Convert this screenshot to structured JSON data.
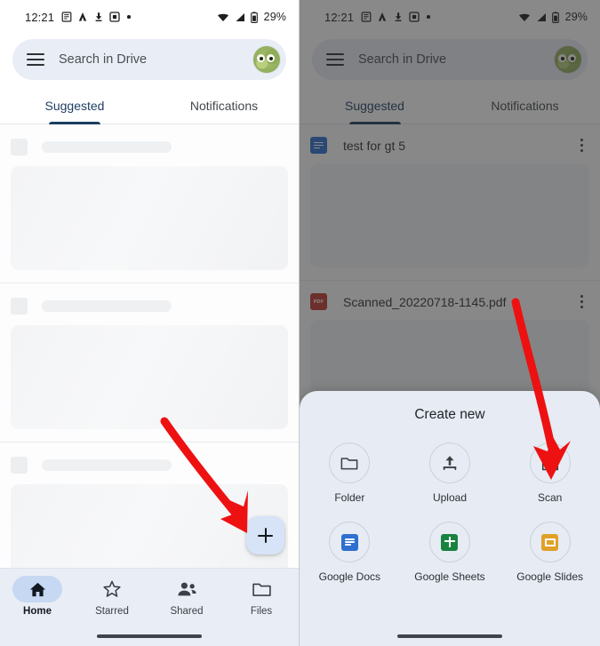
{
  "screenshot": {
    "kind": "android-google-drive-tutorial",
    "panels": 2
  },
  "status_bar": {
    "clock": "12:21",
    "left_icons": [
      "notes-notification-icon",
      "app-notification-icon",
      "download-notification-icon",
      "screenshot-notification-icon",
      "overflow-dot-icon"
    ],
    "right_icons": [
      "wifi-icon",
      "cellular-signal-icon",
      "battery-icon"
    ],
    "battery_percent": "29%"
  },
  "search": {
    "placeholder": "Search in Drive",
    "menu_icon": "hamburger-menu-icon",
    "avatar_icon": "account-avatar"
  },
  "tabs": [
    {
      "label": "Suggested",
      "active": true
    },
    {
      "label": "Notifications",
      "active": false
    }
  ],
  "bottom_nav": [
    {
      "label": "Home",
      "icon": "home-icon",
      "active": true
    },
    {
      "label": "Starred",
      "icon": "star-icon",
      "active": false
    },
    {
      "label": "Shared",
      "icon": "people-icon",
      "active": false
    },
    {
      "label": "Files",
      "icon": "folder-icon",
      "active": false
    }
  ],
  "fab": {
    "icon": "plus-icon",
    "label": "Create new",
    "color": "#d7e3f7"
  },
  "left_panel": {
    "skeleton_cards": [
      {
        "state": "loading-placeholder"
      },
      {
        "state": "loading-placeholder"
      },
      {
        "state": "loading-placeholder"
      }
    ]
  },
  "right_panel": {
    "files": [
      {
        "name": "test for gt 5",
        "icon": "google-docs-file-icon",
        "icon_color": "#2f6fd0",
        "menu": "overflow-menu-icon"
      },
      {
        "name": "Scanned_20220718-1145.pdf",
        "icon": "pdf-file-icon",
        "icon_color": "#c0392f",
        "menu": "overflow-menu-icon"
      }
    ],
    "scrim": true
  },
  "create_sheet": {
    "title": "Create new",
    "options": [
      {
        "label": "Folder",
        "icon": "folder-outline-icon",
        "color": "#3c4043"
      },
      {
        "label": "Upload",
        "icon": "upload-icon",
        "color": "#3c4043"
      },
      {
        "label": "Scan",
        "icon": "camera-scan-icon",
        "color": "#3c4043"
      },
      {
        "label": "Google Docs",
        "icon": "google-docs-icon",
        "color": "#2f6fd0"
      },
      {
        "label": "Google Sheets",
        "icon": "google-sheets-icon",
        "color": "#18833f"
      },
      {
        "label": "Google Slides",
        "icon": "google-slides-icon",
        "color": "#e0a128"
      }
    ]
  },
  "annotations": [
    {
      "type": "arrow",
      "color": "#ee1111",
      "points_to": "create-fab"
    },
    {
      "type": "arrow",
      "color": "#ee1111",
      "points_to": "scan-option"
    }
  ]
}
